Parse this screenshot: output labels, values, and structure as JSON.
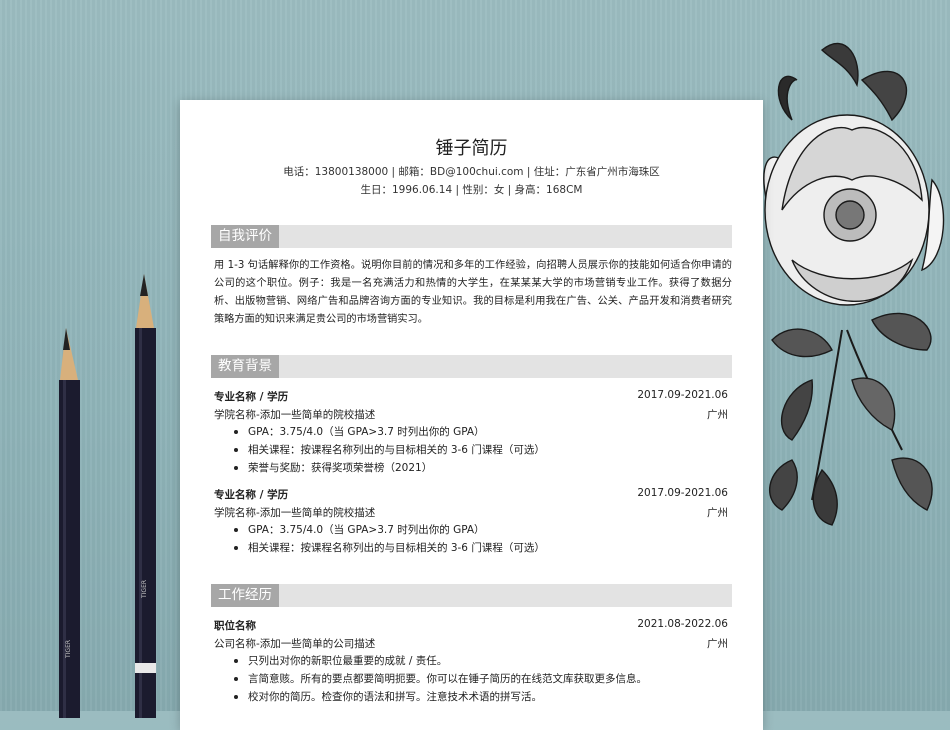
{
  "resume": {
    "name": "锤子简历",
    "contact_line1": "电话：13800138000 | 邮箱：BD@100chui.com | 住址：广东省广州市海珠区",
    "contact_line2": "生日：1996.06.14 | 性别：女 | 身高：168CM",
    "sections": {
      "self_eval": {
        "title": "自我评价",
        "text": "用 1-3 句话解释你的工作资格。说明你目前的情况和多年的工作经验，向招聘人员展示你的技能如何适合你申请的公司的这个职位。例子：我是一名充满活力和热情的大学生，在某某某大学的市场营销专业工作。获得了数据分析、出版物营销、网络广告和品牌咨询方面的专业知识。我的目标是利用我在广告、公关、产品开发和消费者研究策略方面的知识来满足贵公司的市场营销实习。"
      },
      "education": {
        "title": "教育背景",
        "entries": [
          {
            "major": "专业名称 / 学历",
            "date": "2017.09-2021.06",
            "school": "学院名称-添加一些简单的院校描述",
            "city": "广州",
            "bullets": [
              "GPA：3.75/4.0（当 GPA>3.7 时列出你的 GPA）",
              "相关课程：按课程名称列出的与目标相关的 3-6 门课程（可选）",
              "荣誉与奖励：获得奖项荣誉榜（2021）"
            ]
          },
          {
            "major": "专业名称 / 学历",
            "date": "2017.09-2021.06",
            "school": "学院名称-添加一些简单的院校描述",
            "city": "广州",
            "bullets": [
              "GPA：3.75/4.0（当 GPA>3.7 时列出你的 GPA）",
              "相关课程：按课程名称列出的与目标相关的 3-6 门课程（可选）"
            ]
          }
        ]
      },
      "work": {
        "title": "工作经历",
        "entries": [
          {
            "position": "职位名称",
            "date": "2021.08-2022.06",
            "company": "公司名称-添加一些简单的公司描述",
            "city": "广州",
            "bullets": [
              "只列出对你的新职位最重要的成就 / 责任。",
              "言简意赅。所有的要点都要简明扼要。你可以在锤子简历的在线范文库获取更多信息。",
              "校对你的简历。检查你的语法和拼写。注意技术术语的拼写活。"
            ]
          }
        ]
      }
    }
  },
  "colors": {
    "background": "#8fb3b8",
    "section_title_bg": "#a7a7a7",
    "section_bar_bg": "#e3e3e3",
    "pencil": "#1b1b2e"
  },
  "icons": {
    "decor_left": "pencil-icon",
    "decor_right": "flower-illustration"
  }
}
